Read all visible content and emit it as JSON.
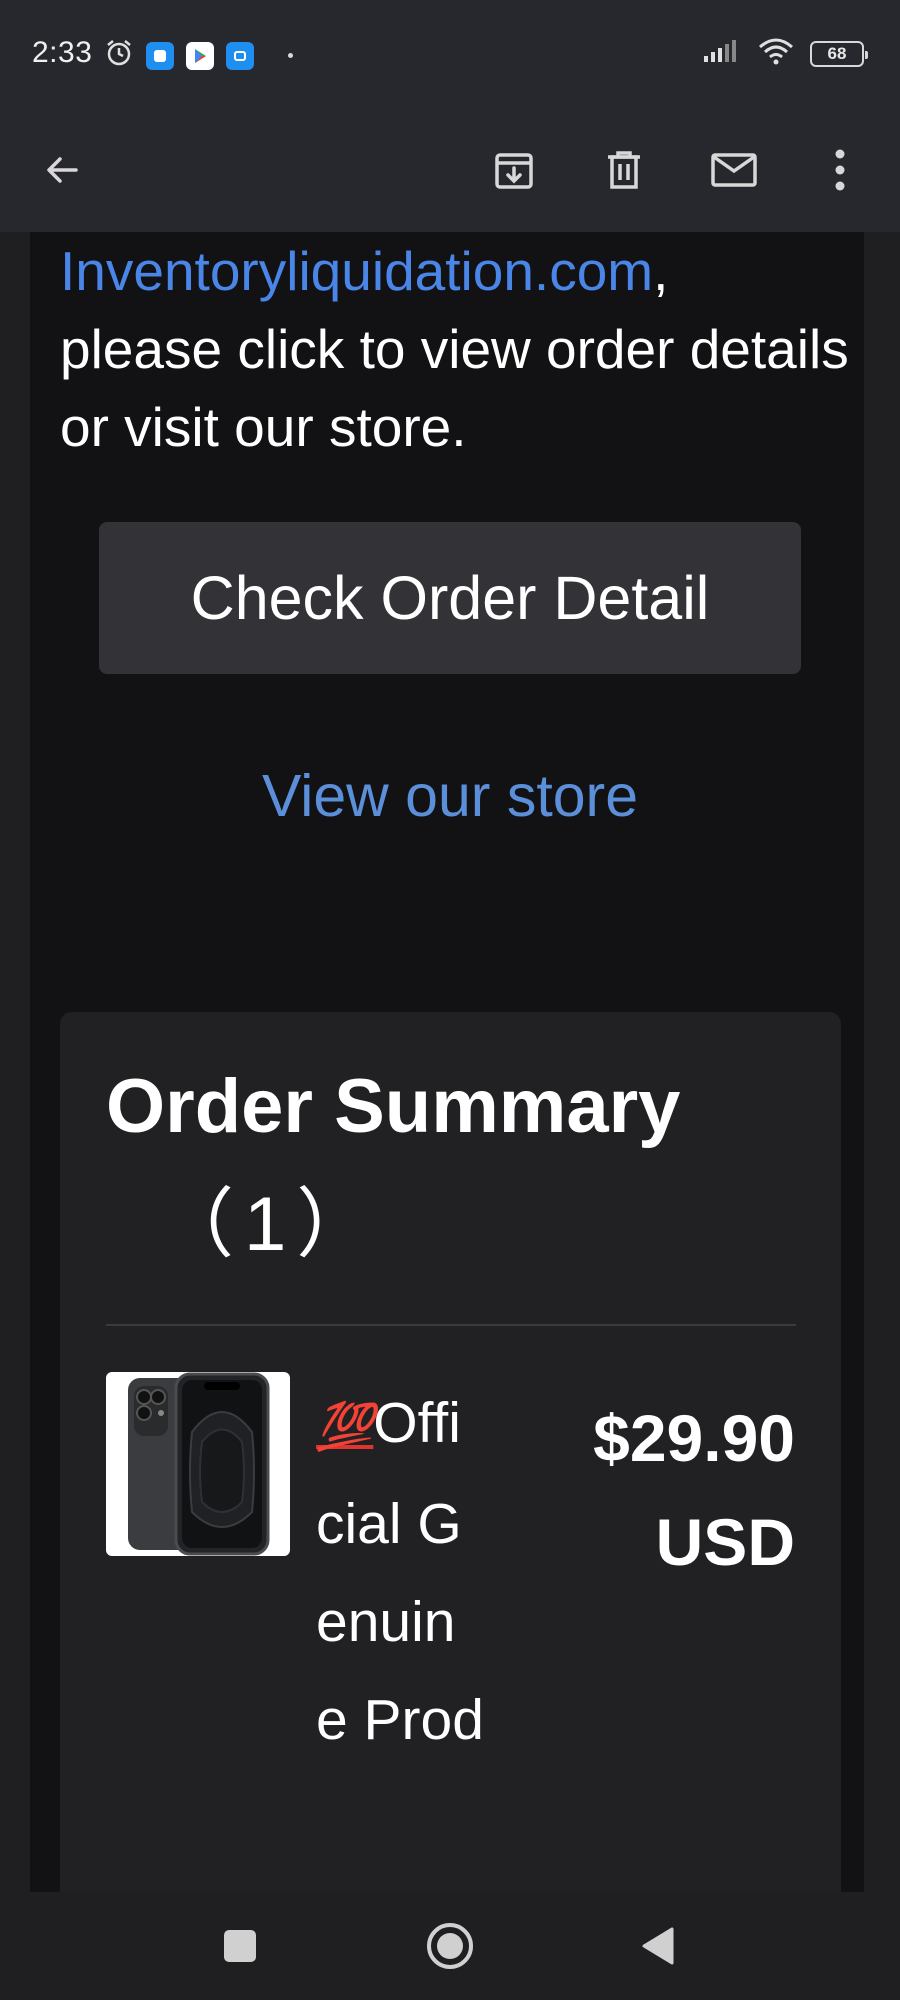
{
  "status_bar": {
    "time": "2:33",
    "battery": "68",
    "icons": [
      "alarm-icon",
      "app-icon",
      "play-store-icon",
      "app-icon",
      "signal-icon",
      "wifi-icon",
      "battery-icon"
    ]
  },
  "app_bar": {
    "icons": [
      "back-arrow-icon",
      "archive-icon",
      "delete-icon",
      "mail-icon",
      "more-vert-icon"
    ]
  },
  "email": {
    "intro_link": "Inventoryliquidation.com",
    "intro_comma": ",",
    "intro_text": "please click to view order details or visit our store.",
    "order_button": "Check Order Detail",
    "store_link": "View our store",
    "summary": {
      "title": "Order Summary",
      "count": "（1）",
      "item": {
        "emoji": "💯",
        "name": "Official Genuine Prod",
        "price_amount": "$29.90",
        "price_currency": "USD"
      }
    }
  },
  "nav_bar": {
    "icons": [
      "recents-square-icon",
      "home-circle-icon",
      "back-triangle-icon"
    ]
  },
  "colors": {
    "link": "#4a85e8",
    "store_link": "#5b8fd9",
    "button_bg": "#333237",
    "card_bg": "#212124"
  }
}
